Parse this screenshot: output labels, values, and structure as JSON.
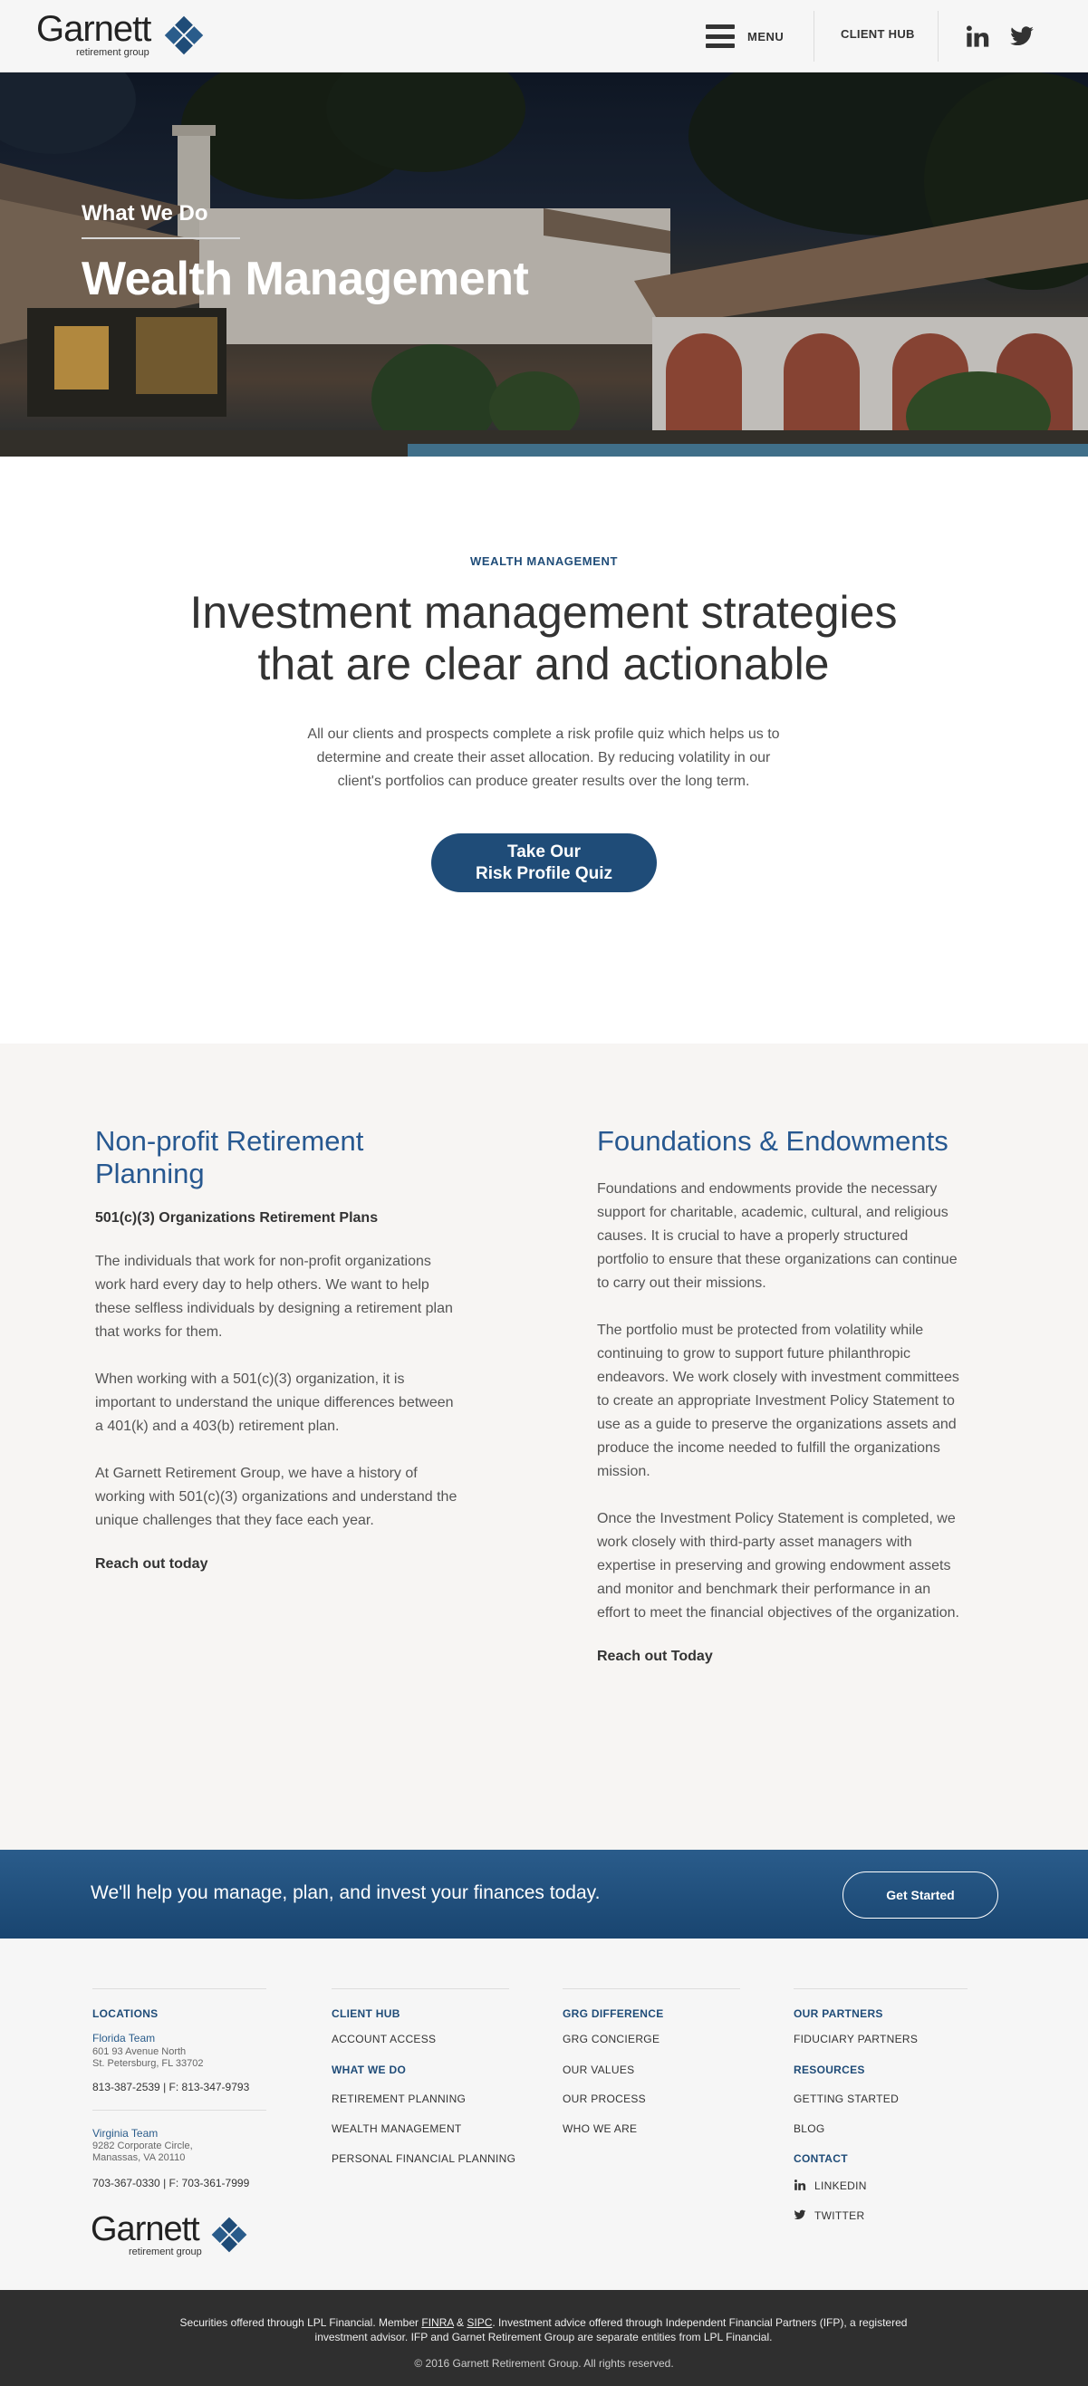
{
  "header": {
    "logo_word": "Garnett",
    "logo_sub": "retirement group",
    "menu_label": "MENU",
    "client_hub": "CLIENT HUB",
    "social": [
      "linkedin-icon",
      "twitter-icon"
    ]
  },
  "hero": {
    "eyebrow": "What We Do",
    "title": "Wealth Management"
  },
  "intro": {
    "eyebrow": "WEALTH MANAGEMENT",
    "title_line1": "Investment management strategies",
    "title_line2": "that are clear and actionable",
    "text": "All our clients and prospects complete a risk profile quiz which helps us to determine and create their asset allocation.  By reducing volatility in our client's portfolios can produce greater results over the long term.",
    "button_line1": "Take Our",
    "button_line2": "Risk Profile Quiz"
  },
  "nonprofit": {
    "title": "Non-profit Retirement Planning",
    "subhead": "501(c)(3) Organizations Retirement Plans",
    "paragraphs": [
      "The individuals that work for non-profit organizations work hard every day to help others. We want to help these selfless individuals by designing a retirement plan that works for them.",
      "When working with a 501(c)(3) organization, it is important to understand the unique differences between a 401(k) and a 403(b) retirement plan.",
      "At Garnett Retirement Group, we have a history of working with 501(c)(3) organizations and understand the unique challenges that they face each year."
    ],
    "reach": "Reach out today"
  },
  "foundations": {
    "title": "Foundations & Endowments",
    "paragraphs": [
      "Foundations and endowments provide the necessary support for charitable, academic, cultural, and religious causes. It is crucial to have a properly structured portfolio to ensure that these organizations can continue to carry out their missions.",
      "The portfolio must be protected from volatility while continuing to grow to support future philanthropic endeavors. We work closely with investment committees to create an appropriate Investment Policy Statement to use as a guide to preserve the organizations assets and produce the income needed to fulfill the organizations mission.",
      "Once the Investment Policy Statement is completed, we work closely with third-party asset managers with expertise in preserving and growing endowment assets and monitor and benchmark their performance in an effort to meet the financial objectives of the organization."
    ],
    "reach": "Reach out Today"
  },
  "cta": {
    "text": "We'll help you manage, plan, and invest your finances today.",
    "button": "Get Started"
  },
  "footer": {
    "locations_head": "LOCATIONS",
    "florida_name": "Florida Team",
    "florida_addr1": "601 93 Avenue North",
    "florida_addr2": "St. Petersburg, FL 33702",
    "florida_phone": "813-387-2539 | F: 813-347-9793",
    "virginia_name": "Virginia Team",
    "virginia_addr1": "9282 Corporate Circle,",
    "virginia_addr2": "Manassas, VA 20110",
    "virginia_phone": "703-367-0330 | F: 703-361-7999",
    "client_hub_head": "CLIENT HUB",
    "account_access": "ACCOUNT ACCESS",
    "what_we_do_head": "WHAT WE DO",
    "retirement_planning": "RETIREMENT PLANNING",
    "wealth_management": "WEALTH MANAGEMENT",
    "personal_financial": "PERSONAL FINANCIAL PLANNING",
    "grg_head": "GRG DIFFERENCE",
    "grg_concierge": "GRG CONCIERGE",
    "our_values": "OUR VALUES",
    "our_process": "OUR PROCESS",
    "who_we_are": "WHO WE ARE",
    "partners_head": "OUR PARTNERS",
    "fiduciary": "FIDUCIARY PARTNERS",
    "resources_head": "RESOURCES",
    "getting_started": "GETTING STARTED",
    "blog": "BLOG",
    "contact_head": "CONTACT",
    "linkedin": "LINKEDIN",
    "twitter": "TWITTER"
  },
  "bottom": {
    "legal_1": "Securities offered through LPL Financial. Member ",
    "finra": "FINRA",
    "amp": " & ",
    "sipc": "SIPC",
    "legal_2": ". Investment advice offered through Independent Financial Partners (IFP), a registered investment advisor.  IFP and Garnet Retirement Group are separate entities from LPL Financial.",
    "copyright": "© 2016 Garnett Retirement Group. All rights reserved."
  }
}
